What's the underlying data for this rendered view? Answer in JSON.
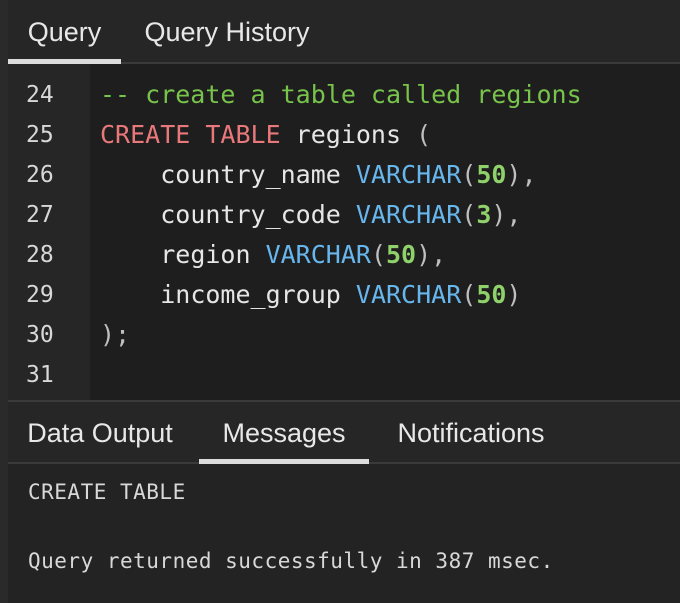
{
  "top_tabs": {
    "query": "Query",
    "query_history": "Query History"
  },
  "editor": {
    "line_numbers": [
      "24",
      "25",
      "26",
      "27",
      "28",
      "29",
      "30",
      "31"
    ],
    "lines": [
      {
        "comment": "-- create a table called regions"
      },
      {
        "keyword": "CREATE TABLE",
        "text": " regions ",
        "punct": "("
      },
      {
        "indent": "    ",
        "name": "country_name ",
        "type": "VARCHAR",
        "open": "(",
        "size": "50",
        "close": "),"
      },
      {
        "indent": "    ",
        "name": "country_code ",
        "type": "VARCHAR",
        "open": "(",
        "size": "3",
        "close": "),"
      },
      {
        "indent": "    ",
        "name": "region ",
        "type": "VARCHAR",
        "open": "(",
        "size": "50",
        "close": "),"
      },
      {
        "indent": "    ",
        "name": "income_group ",
        "type": "VARCHAR",
        "open": "(",
        "size": "50",
        "close": ")"
      },
      {
        "punct": ");"
      }
    ]
  },
  "bottom_tabs": {
    "data_output": "Data Output",
    "messages": "Messages",
    "notifications": "Notifications"
  },
  "messages": {
    "line1": "CREATE TABLE",
    "line2": "Query returned successfully in 387 msec."
  },
  "colors": {
    "keyword": "#e8787a",
    "type": "#67b7ee",
    "number": "#8fd16a",
    "comment": "#78c34b",
    "background": "#1e1e1e"
  }
}
